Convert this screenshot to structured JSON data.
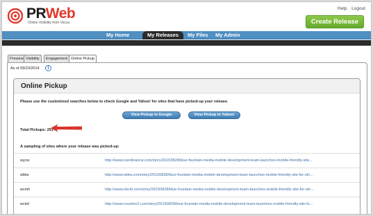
{
  "header": {
    "logo_text_pr": "PR",
    "logo_text_web": "Web",
    "logo_tagline": "Online Visibility from Vocus",
    "links": [
      "Help",
      "Logout"
    ],
    "create_release_label": "Create Release"
  },
  "nav": {
    "items": [
      "My Home",
      "My Releases",
      "My Files",
      "My Admin"
    ],
    "active": "My Releases"
  },
  "tabs": [
    "Preview",
    "Visibility",
    "Engagement",
    "Online Pickup"
  ],
  "active_tab": "Online Pickup",
  "as_of": "As of 09/23/2014",
  "info_icon_glyph": "i",
  "pickup": {
    "title": "Online Pickup",
    "description": "Please use the customized searches below to check Google and Yahoo! for sites that have picked-up your release.",
    "google_button": "View Pickup in Google",
    "yahoo_button": "View Pickup in Yahoo!",
    "total_label": "Total Pickups: 291",
    "sampling_label": "A sampling of sites where your release was picked-up:",
    "sites": [
      {
        "call": "wycw",
        "url": "http://www.carolinascw.com/story/26150828/blue-fountain-media-mobile-development-team-launches-mobile-friendly-site..."
      },
      {
        "call": "wbtw",
        "url": "http://www.wbtw.com/story/26150828/blue-fountain-media-mobile-development-team-launches-mobile-friendly-site-for-wh..."
      },
      {
        "call": "wcmh",
        "url": "http://www.nbc4i.com/story/26150828/blue-fountain-media-mobile-development-team-launches-mobile-friendly-site-for-wh..."
      },
      {
        "call": "wcbd",
        "url": "http://www.counton2.com/story/26150828/blue-fountain-media-mobile-development-team-launches-mobile-friendly-site-fo..."
      }
    ]
  },
  "colors": {
    "brand_red": "#e0372b",
    "nav_blue": "#4f8fc2",
    "create_green": "#64a92b",
    "link_blue": "#3d6fa6",
    "annotation_arrow": "#d9342b"
  },
  "icons": {
    "logo_mark": "prweb-target-logo-icon",
    "info": "info-circle-icon",
    "annotation": "red-arrow-left-icon"
  }
}
